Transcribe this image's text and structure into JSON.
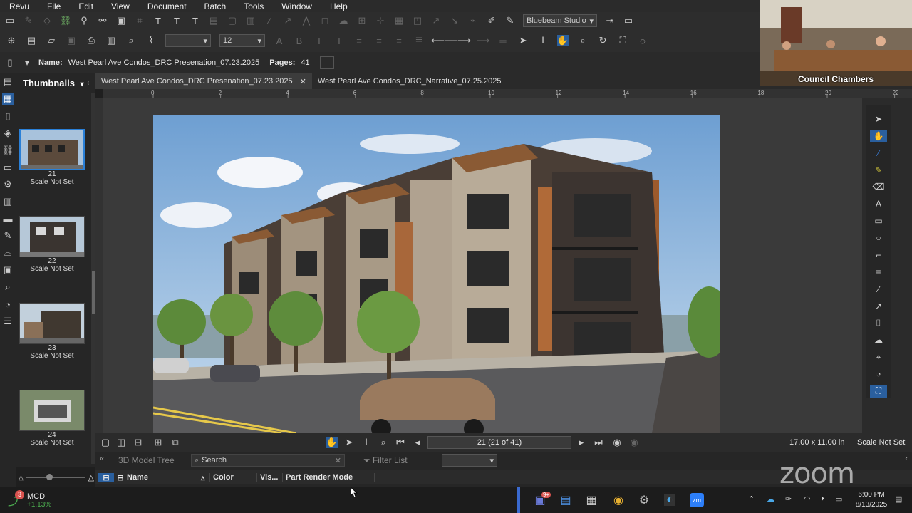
{
  "menu": [
    "Revu",
    "File",
    "Edit",
    "View",
    "Document",
    "Batch",
    "Tools",
    "Window",
    "Help"
  ],
  "toolbar": {
    "profile": "Bluebeam Studio",
    "font_size": "12"
  },
  "document": {
    "name_label": "Name:",
    "name_value": "West Pearl Ave Condos_DRC Presenation_07.23.2025",
    "pages_label": "Pages:",
    "pages_value": "41"
  },
  "tabs": [
    {
      "label": "West Pearl Ave Condos_DRC Presenation_07.23.2025",
      "active": true
    },
    {
      "label": "West Pearl Ave Condos_DRC_Narrative_07.25.2025",
      "active": false
    }
  ],
  "thumbnails": {
    "title": "Thumbnails",
    "items": [
      {
        "num": "21",
        "scale": "Scale Not Set",
        "selected": true
      },
      {
        "num": "22",
        "scale": "Scale Not Set",
        "selected": false
      },
      {
        "num": "23",
        "scale": "Scale Not Set",
        "selected": false
      },
      {
        "num": "24",
        "scale": "Scale Not Set",
        "selected": false
      }
    ]
  },
  "ruler_ticks": [
    "0",
    "2",
    "4",
    "6",
    "8",
    "10",
    "12",
    "14",
    "16",
    "18",
    "20",
    "22"
  ],
  "status": {
    "page_indicator": "21 (21 of 41)",
    "page_size": "17.00 x 11.00 in",
    "scale": "Scale Not Set"
  },
  "bottom_panel": {
    "tree_title": "3D Model Tree",
    "search_placeholder": "Search",
    "filter_label": "Filter List",
    "columns": [
      "Name",
      "Color",
      "Vis...",
      "Part Render Mode"
    ]
  },
  "webcam": {
    "label": "Council Chambers"
  },
  "zoom_watermark": "zoom",
  "taskbar": {
    "ticker": "MCD",
    "change": "+1.13%",
    "badge": "3",
    "teams_badge": "9+",
    "time": "6:00 PM",
    "date": "8/13/2025"
  },
  "colors": {
    "accent": "#2a80d8",
    "active_tool": "#2a5f9e",
    "ticker_change": "#4caf50"
  }
}
